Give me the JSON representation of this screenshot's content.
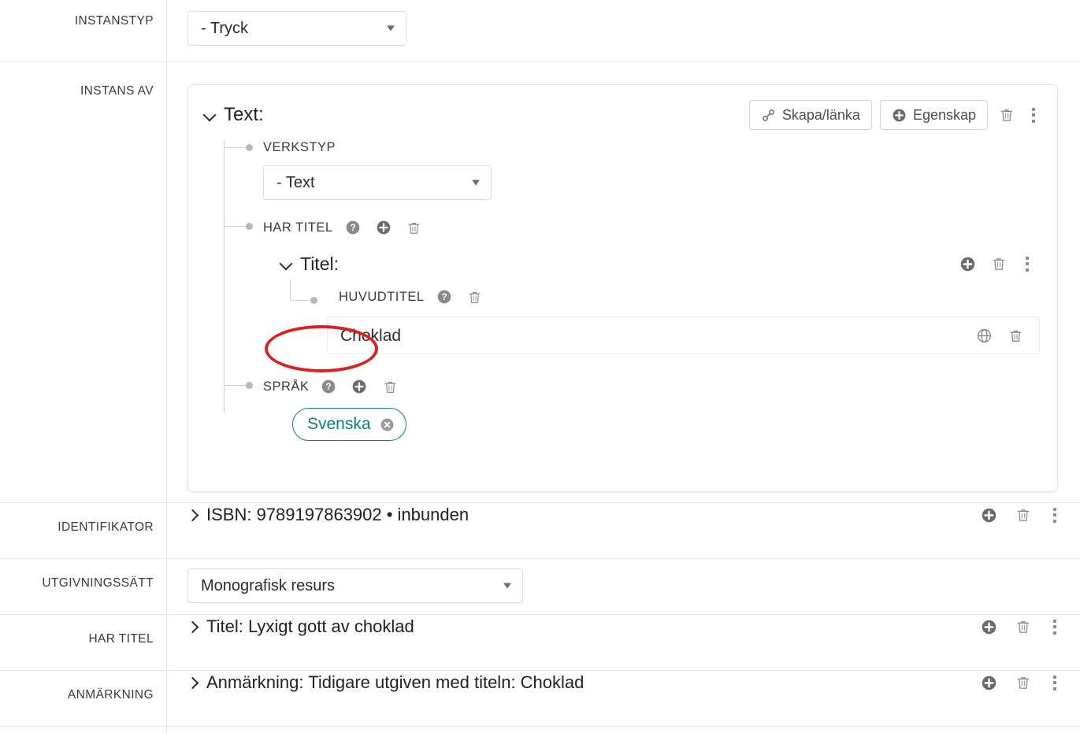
{
  "rows": {
    "instanstyp": {
      "label": "INSTANSTYP",
      "select_value": "- Tryck"
    },
    "instans_av": {
      "label": "INSTANS AV",
      "card": {
        "title": "Text:",
        "buttons": {
          "link": "Skapa/länka",
          "property": "Egenskap"
        },
        "icons": {
          "link_icon": "chain-link-icon",
          "property_icon": "plus-circle-icon",
          "delete_icon": "trash-icon",
          "more_icon": "kebab-menu-icon",
          "collapse_icon": "chevron-down-icon"
        },
        "nodes": [
          {
            "label": "VERKSTYP",
            "type": "select",
            "value": "- Text",
            "icons": []
          },
          {
            "label": "HAR TITEL",
            "type": "entity",
            "icons": [
              "help-circle-icon",
              "plus-circle-icon",
              "trash-icon"
            ],
            "sub_entity": {
              "title": "Titel:",
              "actions": [
                "plus-circle-icon",
                "trash-icon",
                "kebab-menu-icon"
              ],
              "sub_nodes": [
                {
                  "label": "HUVUDTITEL",
                  "icons": [
                    "help-circle-icon",
                    "trash-icon"
                  ],
                  "input_value": "Choklad",
                  "input_trailing_icons": [
                    "globe-icon",
                    "trash-icon"
                  ]
                }
              ]
            }
          },
          {
            "label": "SPRÅK",
            "type": "chip",
            "icons": [
              "help-circle-icon",
              "plus-circle-icon",
              "trash-icon"
            ],
            "chip": {
              "label": "Svenska",
              "remove_icon": "remove-circle-icon"
            }
          }
        ]
      }
    },
    "identifikator": {
      "label": "IDENTIFIKATOR",
      "summary": "ISBN: 9789197863902 • inbunden",
      "actions": [
        "plus-circle-icon",
        "trash-icon",
        "kebab-menu-icon"
      ]
    },
    "utgivningssatt": {
      "label": "UTGIVNINGSSÄTT",
      "select_value": "Monografisk resurs"
    },
    "har_titel": {
      "label": "HAR TITEL",
      "summary": "Titel: Lyxigt gott av choklad",
      "actions": [
        "plus-circle-icon",
        "trash-icon",
        "kebab-menu-icon"
      ]
    },
    "anmarkning": {
      "label": "ANMÄRKNING",
      "summary": "Anmärkning: Tidigare utgiven med titeln: Choklad",
      "actions": [
        "plus-circle-icon",
        "trash-icon",
        "kebab-menu-icon"
      ]
    }
  },
  "annotation": {
    "shape": "ellipse",
    "color": "#d92121",
    "targets": "Choklad"
  },
  "colors": {
    "accent_teal": "#0f7b7b",
    "annotation_red": "#d92121",
    "border": "#e8e8e8",
    "icon_gray": "#8a8a8a",
    "text": "#2b2b2b"
  }
}
